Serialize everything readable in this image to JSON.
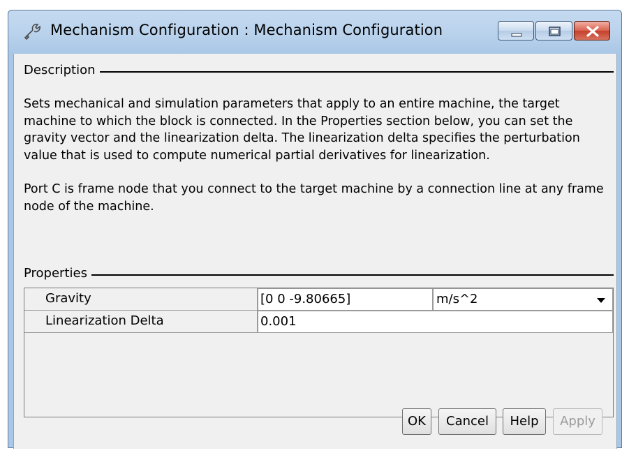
{
  "window": {
    "title": "Mechanism Configuration : Mechanism Configuration",
    "icon": "block-parameters-icon",
    "controls": [
      "minimize",
      "maximize",
      "close"
    ]
  },
  "description": {
    "label": "Description",
    "paragraph1": "Sets mechanical and simulation parameters that apply to an entire machine, the target machine to which the block is connected. In the Properties section below, you can set the gravity vector and the linearization delta. The linearization delta specifies the perturbation value that is used to compute numerical partial derivatives for linearization.",
    "paragraph2": "Port C is frame node that you connect to the target machine by a connection line at any frame node of the machine."
  },
  "properties": {
    "label": "Properties",
    "rows": [
      {
        "name": "Gravity",
        "value": "[0 0 -9.80665]",
        "unit": "m/s^2"
      },
      {
        "name": "Linearization Delta",
        "value": "0.001"
      }
    ]
  },
  "buttons": {
    "ok": "OK",
    "cancel": "Cancel",
    "help": "Help",
    "apply": "Apply"
  },
  "colors": {
    "titlebar": "#b9d2ec",
    "close_button": "#c5402b",
    "dialog_background": "#f0f0f0"
  }
}
